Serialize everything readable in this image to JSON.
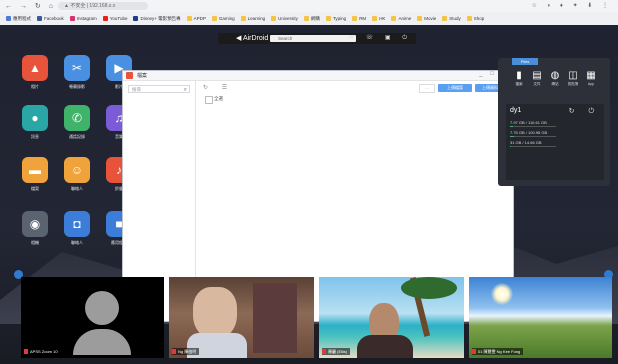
{
  "browser": {
    "nav_glyphs": "← → ↻ ⌂",
    "url": "▲ 不安全 | 192.168.x.x",
    "tool_glyphs": "☆ ◑ ♦ ✦ ⬇ ⋮",
    "bookmarks": [
      {
        "label": "應用程式",
        "color": "#4a7bd6"
      },
      {
        "label": "Facebook",
        "color": "#3b5998"
      },
      {
        "label": "Instagram",
        "color": "#d6336c"
      },
      {
        "label": "YouTube",
        "color": "#e62117"
      },
      {
        "label": "Disney+ 電影預告專",
        "color": "#1e3a8a"
      },
      {
        "label": "APDP",
        "color": "#f4c542"
      },
      {
        "label": "Gaming",
        "color": "#f4c542"
      },
      {
        "label": "Learning",
        "color": "#f4c542"
      },
      {
        "label": "University",
        "color": "#f4c542"
      },
      {
        "label": "網購",
        "color": "#f4c542"
      },
      {
        "label": "Typing",
        "color": "#f4c542"
      },
      {
        "label": "RM",
        "color": "#f4c542"
      },
      {
        "label": "HK",
        "color": "#f4c542"
      },
      {
        "label": "Anime",
        "color": "#f4c542"
      },
      {
        "label": "Movie",
        "color": "#f4c542"
      },
      {
        "label": "Study",
        "color": "#f4c542"
      },
      {
        "label": "Shop",
        "color": "#f4c542"
      }
    ]
  },
  "airdroid_bar": {
    "title": "◀ AirDroid",
    "search_placeholder": "Search",
    "button_glyphs": "✉ ☏ ▣ ⏻"
  },
  "apps": [
    {
      "label": "相片",
      "glyph": "▲",
      "color": "#e8533b"
    },
    {
      "label": "螢幕錄影",
      "glyph": "✂",
      "color": "#4a90e2"
    },
    {
      "label": "影片",
      "glyph": "▶",
      "color": "#4a90e2"
    },
    {
      "label": "訊息",
      "glyph": "●",
      "color": "#2aa6a6"
    },
    {
      "label": "通話記錄",
      "glyph": "✆",
      "color": "#3fb36a"
    },
    {
      "label": "音樂",
      "glyph": "♫",
      "color": "#7b5bd6"
    },
    {
      "label": "檔案",
      "glyph": "▬",
      "color": "#f0a33a"
    },
    {
      "label": "聯絡人",
      "glyph": "☺",
      "color": "#f0a33a"
    },
    {
      "label": "鈴聲",
      "glyph": "♪",
      "color": "#e8533b"
    },
    {
      "label": "相機",
      "glyph": "◉",
      "color": "#5b6270"
    },
    {
      "label": "聯絡人",
      "glyph": "◘",
      "color": "#3b7dd8"
    },
    {
      "label": "應用程式",
      "glyph": "■",
      "color": "#3b7dd8"
    }
  ],
  "dialog": {
    "title": "檔案",
    "window_controls": "_ □ ×",
    "search_placeholder": "搜尋",
    "toolbar_glyphs": "↻ ☰",
    "select_all": "全選",
    "small_box": "⋯",
    "button_1": "上傳檔案",
    "button_2": "上傳資料夾"
  },
  "device_panel": {
    "tab": "Files",
    "icons": [
      {
        "glyph": "▮",
        "label": "檔案"
      },
      {
        "glyph": "▤",
        "label": "文件"
      },
      {
        "glyph": "◍",
        "label": "網站"
      },
      {
        "glyph": "◫",
        "label": "剪貼簿"
      },
      {
        "glyph": "▦",
        "label": "App"
      }
    ],
    "device_name": "dy1",
    "device_icons": "↻ ⏻",
    "storage": [
      {
        "text": "7.97 GB / 110.61 GB",
        "fraction": 0.07
      },
      {
        "text": "7.75 GB / 100.98 GB",
        "fraction": 0.08
      },
      {
        "text": "31 GB / 14.66 GB",
        "fraction": 0.02
      }
    ]
  },
  "participants": [
    {
      "name": "APSS Zoom 10"
    },
    {
      "name": "Ng 陳啟明"
    },
    {
      "name": "陳麗 (Ellis)"
    },
    {
      "name": "01 陳慧雯 Ng Kee Fung"
    }
  ]
}
